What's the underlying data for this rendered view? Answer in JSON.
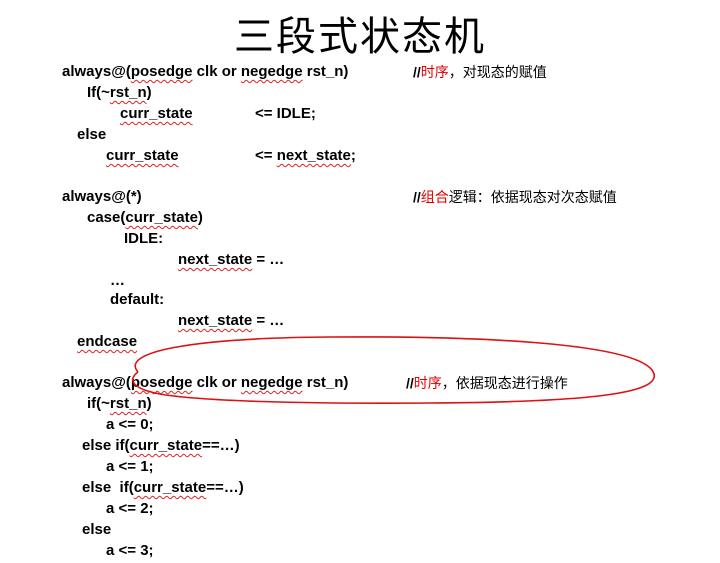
{
  "title": "三段式状态机",
  "block1": {
    "always_kw": "always@(",
    "sens_1": "posedge",
    "sens_2": " clk or ",
    "sens_3": "negedge",
    "sens_4": " rst_n)",
    "comment_slash": "//",
    "comment_red": "时序",
    "comment_rest": "，对现态的赋值",
    "if_prefix": "If(~",
    "if_var": "rst_n",
    "if_suffix": ")",
    "line_curr1": "curr_state",
    "line_assign1": "<= IDLE;",
    "else_kw": "else",
    "line_curr2": "curr_state",
    "line_assign2_pre": "<= ",
    "line_assign2_var": "next_state",
    "line_assign2_post": ";"
  },
  "block2": {
    "always_kw": "always@(*)",
    "comment_slash": "//",
    "comment_red": "组合",
    "comment_rest": "逻辑：依据现态对次态赋值",
    "case_pre": "case(",
    "case_var": "curr_state",
    "case_post": ")",
    "idle_label": "IDLE:",
    "next1_var": "next_state",
    "next1_rest": " = …",
    "ellipsis": "…",
    "default_label": "default:",
    "next2_var": "next_state",
    "next2_rest": " = …",
    "endcase_kw": "endcase"
  },
  "block3": {
    "always_kw": "always@(",
    "sens_1": "posedge",
    "sens_2": " clk or ",
    "sens_3": "negedge",
    "sens_4": " rst_n)",
    "comment_slash": "//",
    "comment_red": "时序",
    "comment_rest": "，依据现态进行操作",
    "if_prefix": "if(~",
    "if_var": "rst_n",
    "if_suffix": ")",
    "a0": "a <= 0;",
    "elseif1_pre": "else if(",
    "elseif1_var": "curr_state",
    "elseif1_post": "==…)",
    "a1": "a <= 1;",
    "elseif2_pre": "else  if(",
    "elseif2_var": "curr_state",
    "elseif2_post": "==…)",
    "a2": "a <= 2;",
    "else_kw": "else",
    "a3": "a <= 3;"
  },
  "colors": {
    "annotation_red": "#e00000",
    "ellipse_red": "#dd1111"
  }
}
